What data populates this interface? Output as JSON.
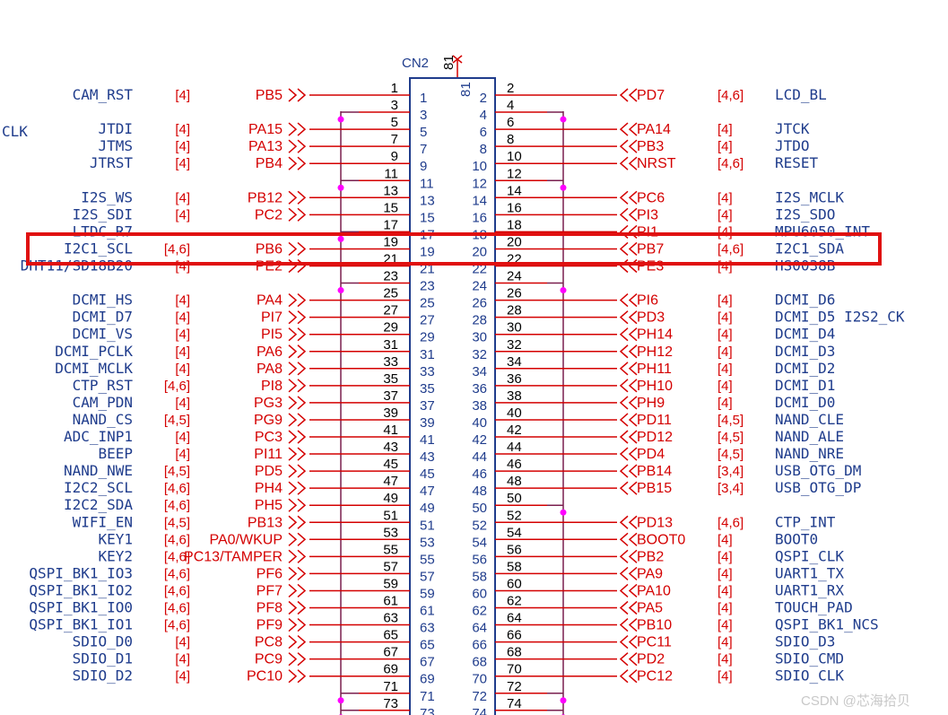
{
  "connector": {
    "name": "CN2",
    "top_pin_label": "81",
    "top_pin_inner": "81"
  },
  "colors": {
    "wire": "#d40000",
    "bus": "#7a1f4f",
    "net": "#1f3c8c",
    "junction": "#ff00ff",
    "highlight": "#e01010",
    "body": "#1f3c8c"
  },
  "left_rows": [
    {
      "pin": "1",
      "inner": "1",
      "gpio": "PB5",
      "ref": "[4]",
      "net": "CAM_RST"
    },
    {
      "pin": "3",
      "inner": "3",
      "gpio": "",
      "ref": "",
      "net": ""
    },
    {
      "pin": "5",
      "inner": "5",
      "gpio": "PA15",
      "ref": "[4]",
      "net": "JTDI"
    },
    {
      "pin": "7",
      "inner": "7",
      "gpio": "PA13",
      "ref": "[4]",
      "net": "JTMS"
    },
    {
      "pin": "9",
      "inner": "9",
      "gpio": "PB4",
      "ref": "[4]",
      "net": "JTRST"
    },
    {
      "pin": "11",
      "inner": "11",
      "gpio": "",
      "ref": "",
      "net": ""
    },
    {
      "pin": "13",
      "inner": "13",
      "gpio": "PB12",
      "ref": "[4]",
      "net": "I2S_WS"
    },
    {
      "pin": "15",
      "inner": "15",
      "gpio": "PC2",
      "ref": "[4]",
      "net": "I2S_SDI"
    },
    {
      "pin": "17",
      "inner": "17",
      "gpio": "",
      "ref": "",
      "net": "LTDC_R7"
    },
    {
      "pin": "19",
      "inner": "19",
      "gpio": "PB6",
      "ref": "[4,6]",
      "net": "I2C1_SCL"
    },
    {
      "pin": "21",
      "inner": "21",
      "gpio": "PE2",
      "ref": "[4]",
      "net": "DHT11/SD18B20"
    },
    {
      "pin": "23",
      "inner": "23",
      "gpio": "",
      "ref": "",
      "net": ""
    },
    {
      "pin": "25",
      "inner": "25",
      "gpio": "PA4",
      "ref": "[4]",
      "net": "DCMI_HS"
    },
    {
      "pin": "27",
      "inner": "27",
      "gpio": "PI7",
      "ref": "[4]",
      "net": "DCMI_D7"
    },
    {
      "pin": "29",
      "inner": "29",
      "gpio": "PI5",
      "ref": "[4]",
      "net": "DCMI_VS"
    },
    {
      "pin": "31",
      "inner": "31",
      "gpio": "PA6",
      "ref": "[4]",
      "net": "DCMI_PCLK"
    },
    {
      "pin": "33",
      "inner": "33",
      "gpio": "PA8",
      "ref": "[4]",
      "net": "DCMI_MCLK"
    },
    {
      "pin": "35",
      "inner": "35",
      "gpio": "PI8",
      "ref": "[4,6]",
      "net": "CTP_RST"
    },
    {
      "pin": "37",
      "inner": "37",
      "gpio": "PG3",
      "ref": "[4]",
      "net": "CAM_PDN"
    },
    {
      "pin": "39",
      "inner": "39",
      "gpio": "PG9",
      "ref": "[4,5]",
      "net": "NAND_CS"
    },
    {
      "pin": "41",
      "inner": "41",
      "gpio": "PC3",
      "ref": "[4]",
      "net": "ADC_INP1"
    },
    {
      "pin": "43",
      "inner": "43",
      "gpio": "PI11",
      "ref": "[4]",
      "net": "BEEP"
    },
    {
      "pin": "45",
      "inner": "45",
      "gpio": "PD5",
      "ref": "[4,5]",
      "net": "NAND_NWE"
    },
    {
      "pin": "47",
      "inner": "47",
      "gpio": "PH4",
      "ref": "[4,6]",
      "net": "I2C2_SCL"
    },
    {
      "pin": "49",
      "inner": "49",
      "gpio": "PH5",
      "ref": "[4,6]",
      "net": "I2C2_SDA"
    },
    {
      "pin": "51",
      "inner": "51",
      "gpio": "PB13",
      "ref": "[4,5]",
      "net": "WIFI_EN"
    },
    {
      "pin": "53",
      "inner": "53",
      "gpio": "PA0/WKUP",
      "ref": "[4,6]",
      "net": "KEY1"
    },
    {
      "pin": "55",
      "inner": "55",
      "gpio": "PC13/TAMPER",
      "ref": "[4,6]",
      "net": "KEY2"
    },
    {
      "pin": "57",
      "inner": "57",
      "gpio": "PF6",
      "ref": "[4,6]",
      "net": "QSPI_BK1_IO3"
    },
    {
      "pin": "59",
      "inner": "59",
      "gpio": "PF7",
      "ref": "[4,6]",
      "net": "QSPI_BK1_IO2"
    },
    {
      "pin": "61",
      "inner": "61",
      "gpio": "PF8",
      "ref": "[4,6]",
      "net": "QSPI_BK1_IO0"
    },
    {
      "pin": "63",
      "inner": "63",
      "gpio": "PF9",
      "ref": "[4,6]",
      "net": "QSPI_BK1_IO1"
    },
    {
      "pin": "65",
      "inner": "65",
      "gpio": "PC8",
      "ref": "[4]",
      "net": "SDIO_D0"
    },
    {
      "pin": "67",
      "inner": "67",
      "gpio": "PC9",
      "ref": "[4]",
      "net": "SDIO_D1"
    },
    {
      "pin": "69",
      "inner": "69",
      "gpio": "PC10",
      "ref": "[4]",
      "net": "SDIO_D2"
    },
    {
      "pin": "71",
      "inner": "71",
      "gpio": "",
      "ref": "",
      "net": ""
    },
    {
      "pin": "73",
      "inner": "73",
      "gpio": "",
      "ref": "",
      "net": ""
    }
  ],
  "right_rows": [
    {
      "pin": "2",
      "inner": "2",
      "gpio": "PD7",
      "ref": "[4,6]",
      "net": "LCD_BL"
    },
    {
      "pin": "4",
      "inner": "4",
      "gpio": "",
      "ref": "",
      "net": ""
    },
    {
      "pin": "6",
      "inner": "6",
      "gpio": "PA14",
      "ref": "[4]",
      "net": "JTCK"
    },
    {
      "pin": "8",
      "inner": "8",
      "gpio": "PB3",
      "ref": "[4]",
      "net": "JTDO"
    },
    {
      "pin": "10",
      "inner": "10",
      "gpio": "NRST",
      "ref": "[4,6]",
      "net": "RESET"
    },
    {
      "pin": "12",
      "inner": "12",
      "gpio": "",
      "ref": "",
      "net": ""
    },
    {
      "pin": "14",
      "inner": "14",
      "gpio": "PC6",
      "ref": "[4]",
      "net": "I2S_MCLK"
    },
    {
      "pin": "16",
      "inner": "16",
      "gpio": "PI3",
      "ref": "[4]",
      "net": "I2S_SDO"
    },
    {
      "pin": "18",
      "inner": "18",
      "gpio": "PI1",
      "ref": "[4]",
      "net": "MPU6050_INT"
    },
    {
      "pin": "20",
      "inner": "20",
      "gpio": "PB7",
      "ref": "[4,6]",
      "net": "I2C1_SDA"
    },
    {
      "pin": "22",
      "inner": "22",
      "gpio": "PE3",
      "ref": "[4]",
      "net": "HS0038B"
    },
    {
      "pin": "24",
      "inner": "24",
      "gpio": "",
      "ref": "",
      "net": ""
    },
    {
      "pin": "26",
      "inner": "26",
      "gpio": "PI6",
      "ref": "[4]",
      "net": "DCMI_D6"
    },
    {
      "pin": "28",
      "inner": "28",
      "gpio": "PD3",
      "ref": "[4]",
      "net": "DCMI_D5 I2S2_CK"
    },
    {
      "pin": "30",
      "inner": "30",
      "gpio": "PH14",
      "ref": "[4]",
      "net": "DCMI_D4"
    },
    {
      "pin": "32",
      "inner": "32",
      "gpio": "PH12",
      "ref": "[4]",
      "net": "DCMI_D3"
    },
    {
      "pin": "34",
      "inner": "34",
      "gpio": "PH11",
      "ref": "[4]",
      "net": "DCMI_D2"
    },
    {
      "pin": "36",
      "inner": "36",
      "gpio": "PH10",
      "ref": "[4]",
      "net": "DCMI_D1"
    },
    {
      "pin": "38",
      "inner": "38",
      "gpio": "PH9",
      "ref": "[4]",
      "net": "DCMI_D0"
    },
    {
      "pin": "40",
      "inner": "40",
      "gpio": "PD11",
      "ref": "[4,5]",
      "net": "NAND_CLE"
    },
    {
      "pin": "42",
      "inner": "42",
      "gpio": "PD12",
      "ref": "[4,5]",
      "net": "NAND_ALE"
    },
    {
      "pin": "44",
      "inner": "44",
      "gpio": "PD4",
      "ref": "[4,5]",
      "net": "NAND_NRE"
    },
    {
      "pin": "46",
      "inner": "46",
      "gpio": "PB14",
      "ref": "[3,4]",
      "net": "USB_OTG_DM"
    },
    {
      "pin": "48",
      "inner": "48",
      "gpio": "PB15",
      "ref": "[3,4]",
      "net": "USB_OTG_DP"
    },
    {
      "pin": "50",
      "inner": "50",
      "gpio": "",
      "ref": "",
      "net": ""
    },
    {
      "pin": "52",
      "inner": "52",
      "gpio": "PD13",
      "ref": "[4,6]",
      "net": "CTP_INT"
    },
    {
      "pin": "54",
      "inner": "54",
      "gpio": "BOOT0",
      "ref": "[4]",
      "net": "BOOT0"
    },
    {
      "pin": "56",
      "inner": "56",
      "gpio": "PB2",
      "ref": "[4]",
      "net": "QSPI_CLK"
    },
    {
      "pin": "58",
      "inner": "58",
      "gpio": "PA9",
      "ref": "[4]",
      "net": "UART1_TX"
    },
    {
      "pin": "60",
      "inner": "60",
      "gpio": "PA10",
      "ref": "[4]",
      "net": "UART1_RX"
    },
    {
      "pin": "62",
      "inner": "62",
      "gpio": "PA5",
      "ref": "[4]",
      "net": "TOUCH_PAD"
    },
    {
      "pin": "64",
      "inner": "64",
      "gpio": "PB10",
      "ref": "[4]",
      "net": "QSPI_BK1_NCS"
    },
    {
      "pin": "66",
      "inner": "66",
      "gpio": "PC11",
      "ref": "[4]",
      "net": "SDIO_D3"
    },
    {
      "pin": "68",
      "inner": "68",
      "gpio": "PD2",
      "ref": "[4]",
      "net": "SDIO_CMD"
    },
    {
      "pin": "70",
      "inner": "70",
      "gpio": "PC12",
      "ref": "[4]",
      "net": "SDIO_CLK"
    },
    {
      "pin": "72",
      "inner": "72",
      "gpio": "",
      "ref": "",
      "net": ""
    },
    {
      "pin": "74",
      "inner": "74",
      "gpio": "",
      "ref": "",
      "net": ""
    }
  ],
  "edge_text_left": "CLK",
  "watermark": "CSDN @芯海拾贝"
}
